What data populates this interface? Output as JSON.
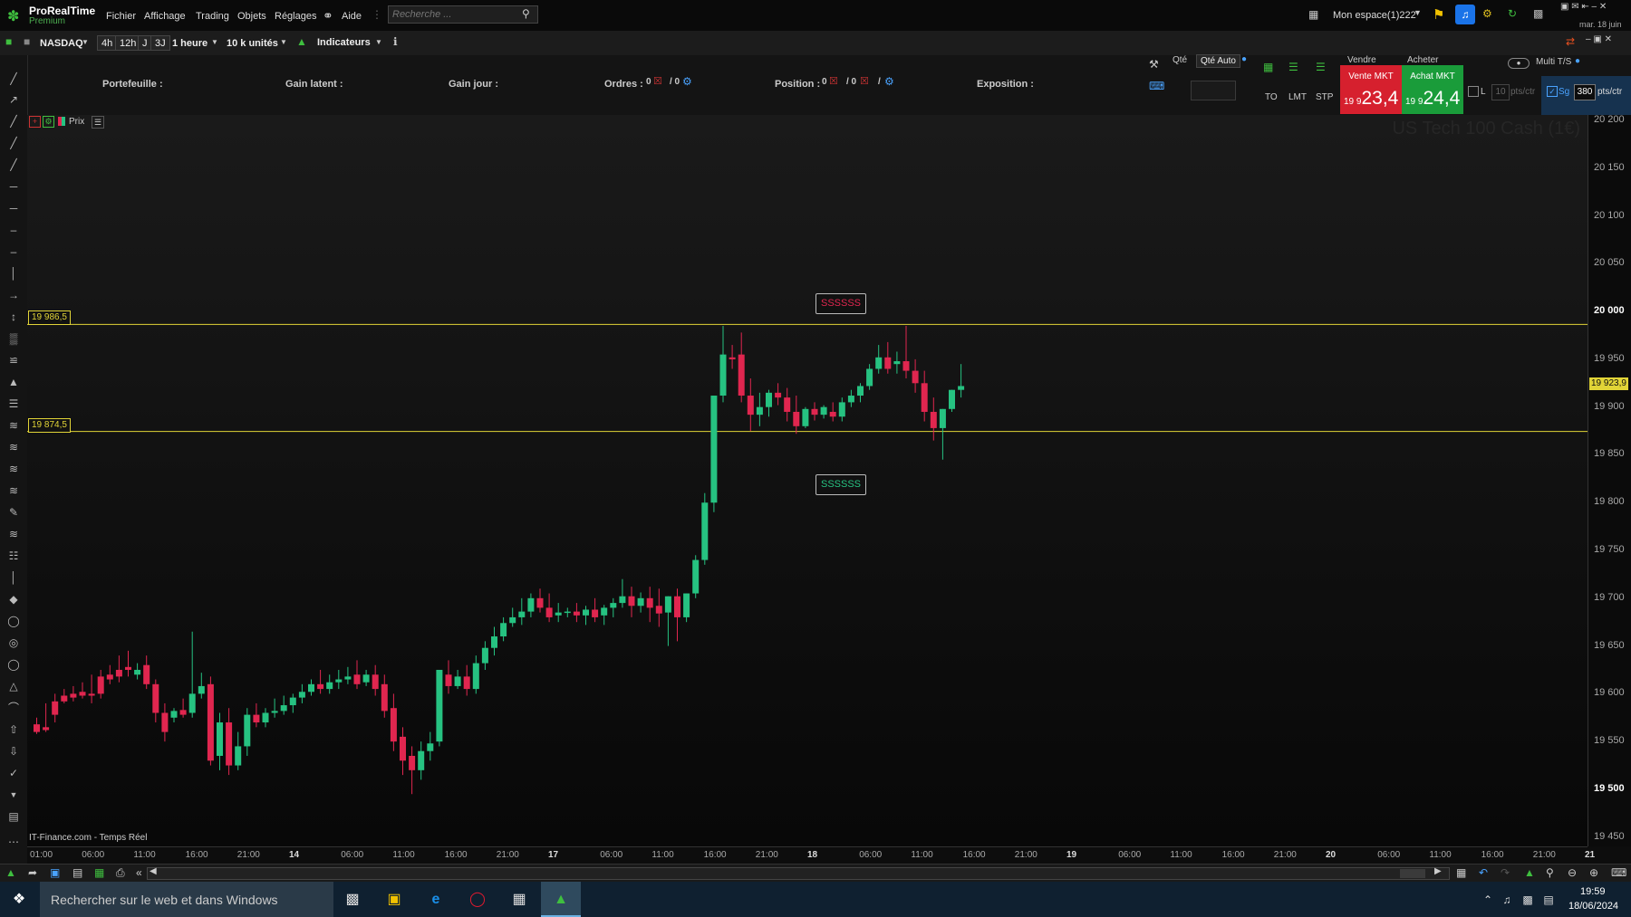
{
  "app": {
    "name": "ProRealTime",
    "edition": "Premium",
    "menus": [
      "Fichier",
      "Affichage",
      "Trading",
      "Objets",
      "Réglages"
    ],
    "help": "Aide",
    "search_placeholder": "Recherche ...",
    "workspace": "Mon espace(1)222",
    "date_short": "mar. 18 juin"
  },
  "toolbar": {
    "market": "NASDAQ",
    "periods": [
      "4h",
      "12h",
      "J",
      "3J"
    ],
    "timeframe": "1 heure",
    "units": "10 k unités",
    "indicators": "Indicateurs"
  },
  "trading": {
    "portfolio_label": "Portefeuille :",
    "unrealized_label": "Gain latent :",
    "day_gain_label": "Gain jour :",
    "orders_label": "Ordres :",
    "orders_a": "0",
    "orders_b": "/ 0",
    "position_label": "Position :",
    "position_a": "0",
    "position_b": "/ 0",
    "position_c": "/",
    "exposure_label": "Exposition :",
    "qty_label": "Qté",
    "qty_auto": "Qté Auto",
    "order_types": [
      "TO",
      "LMT",
      "STP"
    ],
    "sell_label": "Vendre",
    "buy_label": "Acheter",
    "sell_mkt": "Vente MKT",
    "buy_mkt": "Achat MKT",
    "sell_prefix": "19 9",
    "sell_big": "23,4",
    "buy_prefix": "19 9",
    "buy_big": "24,4",
    "multi_ts": "Multi T/S",
    "l_label": "L",
    "l_value": "10",
    "l_unit": "pts/ctr",
    "sg_label": "Sg",
    "sg_value": "380",
    "sg_unit": "pts/ctr"
  },
  "chart": {
    "legend_price": "Prix",
    "watermark": "US Tech 100 Cash (1€)",
    "source": "IT-Finance.com - Temps Réel",
    "y_ticks": [
      "20 200",
      "20 150",
      "20 100",
      "20 050",
      "20 000",
      "19 950",
      "19 900",
      "19 850",
      "19 800",
      "19 750",
      "19 700",
      "19 650",
      "19 600",
      "19 550",
      "19 500",
      "19 450"
    ],
    "current_price": "19 923,9",
    "level_high": "19 986,5",
    "level_low": "19 874,5",
    "signal_sell": "SSSSSS",
    "signal_buy": "SSSSSS",
    "x_ticks": [
      {
        "t": "01:00",
        "d": false
      },
      {
        "t": "06:00",
        "d": false
      },
      {
        "t": "11:00",
        "d": false
      },
      {
        "t": "16:00",
        "d": false
      },
      {
        "t": "21:00",
        "d": false
      },
      {
        "t": "14",
        "d": true
      },
      {
        "t": "06:00",
        "d": false
      },
      {
        "t": "11:00",
        "d": false
      },
      {
        "t": "16:00",
        "d": false
      },
      {
        "t": "21:00",
        "d": false
      },
      {
        "t": "17",
        "d": true
      },
      {
        "t": "06:00",
        "d": false
      },
      {
        "t": "11:00",
        "d": false
      },
      {
        "t": "16:00",
        "d": false
      },
      {
        "t": "21:00",
        "d": false
      },
      {
        "t": "18",
        "d": true
      },
      {
        "t": "06:00",
        "d": false
      },
      {
        "t": "11:00",
        "d": false
      },
      {
        "t": "16:00",
        "d": false
      },
      {
        "t": "21:00",
        "d": false
      },
      {
        "t": "19",
        "d": true
      },
      {
        "t": "06:00",
        "d": false
      },
      {
        "t": "11:00",
        "d": false
      },
      {
        "t": "16:00",
        "d": false
      },
      {
        "t": "21:00",
        "d": false
      },
      {
        "t": "20",
        "d": true
      },
      {
        "t": "06:00",
        "d": false
      },
      {
        "t": "11:00",
        "d": false
      },
      {
        "t": "16:00",
        "d": false
      },
      {
        "t": "21:00",
        "d": false
      },
      {
        "t": "21",
        "d": true
      }
    ]
  },
  "chart_data": {
    "type": "candlestick",
    "title": "US Tech 100 Cash (1€)",
    "ylim": [
      19445,
      20200
    ],
    "horizontal_levels": [
      19986.5,
      19874.5
    ],
    "candles": [
      [
        19568,
        19575,
        19560,
        19558
      ],
      [
        19565,
        19590,
        19562,
        19560
      ],
      [
        19592,
        19600,
        19578,
        19570
      ],
      [
        19598,
        19605,
        19592,
        19590
      ],
      [
        19600,
        19608,
        19596,
        19592
      ],
      [
        19602,
        19612,
        19598,
        19595
      ],
      [
        19600,
        19620,
        19598,
        19590
      ],
      [
        19618,
        19625,
        19600,
        19595
      ],
      [
        19620,
        19630,
        19615,
        19610
      ],
      [
        19625,
        19640,
        19618,
        19612
      ],
      [
        19628,
        19645,
        19625,
        19618
      ],
      [
        19620,
        19632,
        19625,
        19615
      ],
      [
        19630,
        19640,
        19610,
        19605
      ],
      [
        19610,
        19615,
        19580,
        19570
      ],
      [
        19580,
        19590,
        19560,
        19550
      ],
      [
        19575,
        19585,
        19582,
        19570
      ],
      [
        19583,
        19595,
        19578,
        19575
      ],
      [
        19580,
        19665,
        19600,
        19575
      ],
      [
        19600,
        19622,
        19608,
        19595
      ],
      [
        19610,
        19618,
        19530,
        19525
      ],
      [
        19535,
        19580,
        19570,
        19520
      ],
      [
        19570,
        19585,
        19525,
        19515
      ],
      [
        19525,
        19560,
        19545,
        19520
      ],
      [
        19545,
        19585,
        19578,
        19535
      ],
      [
        19578,
        19590,
        19570,
        19565
      ],
      [
        19570,
        19585,
        19580,
        19565
      ],
      [
        19580,
        19595,
        19582,
        19575
      ],
      [
        19582,
        19598,
        19588,
        19578
      ],
      [
        19588,
        19600,
        19596,
        19580
      ],
      [
        19596,
        19610,
        19602,
        19590
      ],
      [
        19602,
        19615,
        19610,
        19598
      ],
      [
        19610,
        19625,
        19605,
        19600
      ],
      [
        19605,
        19620,
        19612,
        19600
      ],
      [
        19612,
        19625,
        19615,
        19605
      ],
      [
        19615,
        19628,
        19618,
        19610
      ],
      [
        19620,
        19635,
        19610,
        19605
      ],
      [
        19612,
        19625,
        19620,
        19608
      ],
      [
        19620,
        19630,
        19605,
        19598
      ],
      [
        19610,
        19620,
        19582,
        19575
      ],
      [
        19585,
        19600,
        19550,
        19540
      ],
      [
        19555,
        19565,
        19530,
        19515
      ],
      [
        19535,
        19545,
        19520,
        19495
      ],
      [
        19520,
        19550,
        19540,
        19510
      ],
      [
        19540,
        19560,
        19548,
        19530
      ],
      [
        19550,
        19580,
        19625,
        19545
      ],
      [
        19620,
        19635,
        19608,
        19600
      ],
      [
        19608,
        19625,
        19618,
        19605
      ],
      [
        19618,
        19630,
        19605,
        19598
      ],
      [
        19605,
        19640,
        19632,
        19600
      ],
      [
        19632,
        19655,
        19648,
        19625
      ],
      [
        19648,
        19670,
        19660,
        19640
      ],
      [
        19660,
        19680,
        19674,
        19655
      ],
      [
        19674,
        19690,
        19680,
        19670
      ],
      [
        19680,
        19700,
        19686,
        19672
      ],
      [
        19686,
        19705,
        19700,
        19680
      ],
      [
        19700,
        19710,
        19690,
        19685
      ],
      [
        19690,
        19705,
        19680,
        19675
      ],
      [
        19682,
        19695,
        19685,
        19675
      ],
      [
        19685,
        19690,
        19686,
        19680
      ],
      [
        19686,
        19695,
        19682,
        19675
      ],
      [
        19682,
        19692,
        19688,
        19672
      ],
      [
        19688,
        19700,
        19680,
        19675
      ],
      [
        19682,
        19693,
        19690,
        19672
      ],
      [
        19690,
        19700,
        19695,
        19680
      ],
      [
        19695,
        19720,
        19702,
        19690
      ],
      [
        19702,
        19712,
        19692,
        19680
      ],
      [
        19692,
        19706,
        19700,
        19685
      ],
      [
        19700,
        19712,
        19690,
        19675
      ],
      [
        19692,
        19710,
        19684,
        19670
      ],
      [
        19685,
        19700,
        19702,
        19650
      ],
      [
        19702,
        19710,
        19680,
        19655
      ],
      [
        19680,
        19705,
        19705,
        19675
      ],
      [
        19705,
        19745,
        19740,
        19700
      ],
      [
        19740,
        19810,
        19800,
        19735
      ],
      [
        19800,
        19835,
        19912,
        19790
      ],
      [
        19912,
        19985,
        19955,
        19905
      ],
      [
        19952,
        19965,
        19950,
        19940
      ],
      [
        19955,
        19978,
        19912,
        19905
      ],
      [
        19912,
        19930,
        19892,
        19875
      ],
      [
        19892,
        19915,
        19900,
        19880
      ],
      [
        19900,
        19918,
        19915,
        19890
      ],
      [
        19915,
        19925,
        19910,
        19902
      ],
      [
        19910,
        19920,
        19895,
        19885
      ],
      [
        19895,
        19912,
        19880,
        19872
      ],
      [
        19880,
        19900,
        19898,
        19878
      ],
      [
        19898,
        19905,
        19892,
        19886
      ],
      [
        19892,
        19902,
        19900,
        19888
      ],
      [
        19895,
        19905,
        19890,
        19885
      ],
      [
        19890,
        19910,
        19905,
        19885
      ],
      [
        19905,
        19918,
        19912,
        19900
      ],
      [
        19912,
        19925,
        19922,
        19905
      ],
      [
        19922,
        19945,
        19940,
        19918
      ],
      [
        19940,
        19965,
        19952,
        19935
      ],
      [
        19952,
        19968,
        19940,
        19935
      ],
      [
        19945,
        19958,
        19948,
        19935
      ],
      [
        19948,
        19985,
        19938,
        19930
      ],
      [
        19938,
        19950,
        19925,
        19915
      ],
      [
        19925,
        19938,
        19895,
        19885
      ],
      [
        19895,
        19910,
        19878,
        19865
      ],
      [
        19878,
        19895,
        19898,
        19845
      ],
      [
        19898,
        19918,
        19918,
        19895
      ],
      [
        19918,
        19945,
        19922,
        19910
      ]
    ]
  },
  "taskbar": {
    "search": "Rechercher sur le web et dans Windows",
    "time": "19:59",
    "date": "18/06/2024"
  },
  "colors": {
    "up": "#26c281",
    "down": "#e0264f",
    "level": "#e1d437",
    "buy_bg": "#1a9c3a",
    "sell_bg": "#d6202e"
  }
}
